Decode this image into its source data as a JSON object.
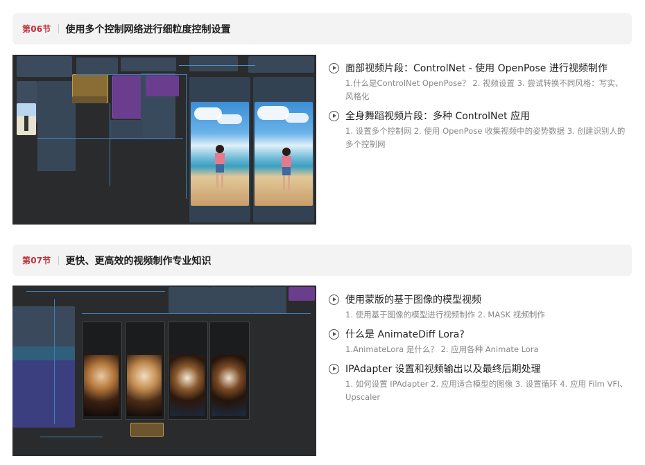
{
  "sections": [
    {
      "num": "第06节",
      "title": "使用多个控制网络进行细粒度控制设置",
      "lessons": [
        {
          "title": "面部视频片段：ControlNet - 使用 OpenPose 进行视频制作",
          "desc": "1.什么是ControlNet OpenPose？ 2. 视频设置 3. 尝试转换不同风格：写实、风格化"
        },
        {
          "title": "全身舞蹈视频片段：多种 ControlNet 应用",
          "desc": "1. 设置多个控制网 2. 使用 OpenPose 收集视频中的姿势数据 3. 创建识别人的多个控制网"
        }
      ]
    },
    {
      "num": "第07节",
      "title": "更快、更高效的视频制作专业知识",
      "lessons": [
        {
          "title": "使用蒙版的基于图像的模型视频",
          "desc": "1. 使用基于图像的模型进行视频制作 2. MASK 视频制作"
        },
        {
          "title": "什么是 AnimateDiff Lora?",
          "desc": "1.AnimateLora 是什么？ 2. 应用各种 Animate Lora"
        },
        {
          "title": "IPAdapter 设置和视频输出以及最终后期处理",
          "desc": "1. 如何设置 IPAdapter 2. 应用适合模型的图像 3. 设置循环 4. 应用 Film VFI、Upscaler"
        }
      ]
    }
  ],
  "colors": {
    "accent": "#c0303a",
    "node_bg": "#3a4a5c",
    "wire": "#3f7fb6",
    "canvas": "#2a2b2d"
  }
}
